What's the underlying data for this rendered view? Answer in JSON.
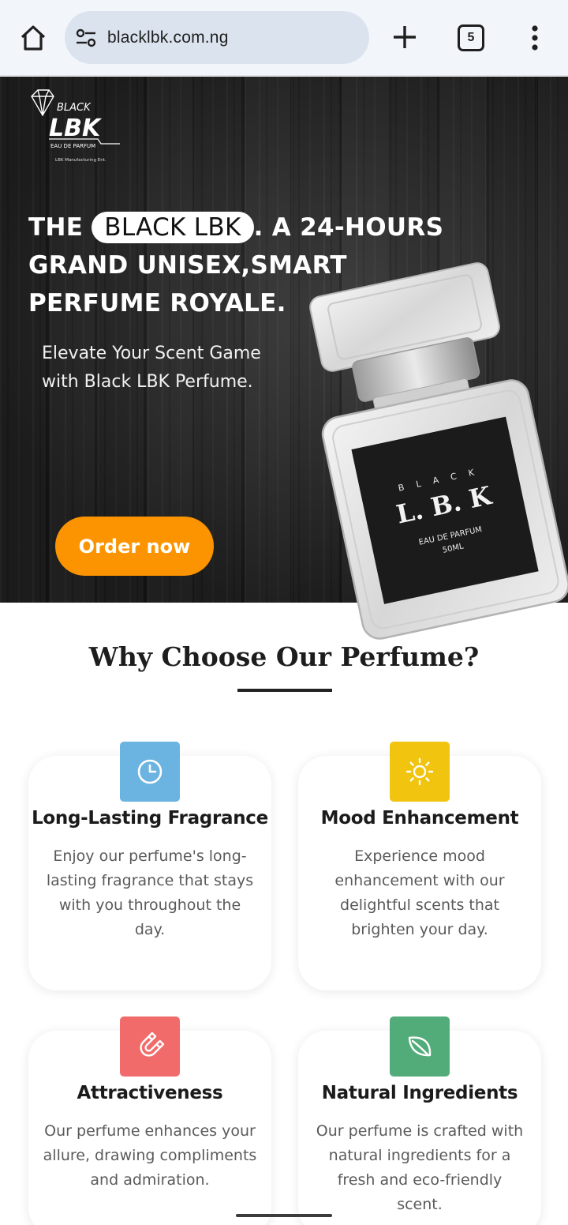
{
  "browser": {
    "url": "blacklbk.com.ng",
    "tab_count": "5"
  },
  "logo": {
    "brand_line1": "BLACK",
    "brand_line2": "LBK",
    "tagline": "EAU DE PARFUM",
    "subline": "LBK Manufacturing Ent."
  },
  "hero": {
    "title_prefix": "THE",
    "title_highlight": "BLACK LBK",
    "title_rest": ". A 24-HOURS GRAND UNISEX,SMART PERFUME ROYALE.",
    "subtitle": "Elevate Your Scent Game with Black LBK Perfume.",
    "cta_label": "Order now",
    "bottle_label": {
      "top": "B L A C K",
      "main": "L. B. K",
      "line1": "EAU DE PARFUM",
      "line2": "50ML"
    }
  },
  "features": {
    "title": "Why Choose Our Perfume?",
    "items": [
      {
        "icon": "clock-icon",
        "color": "#6bb3e0",
        "title": "Long-Lasting Fragrance",
        "text": "Enjoy our perfume's long-lasting fragrance that stays with you throughout the day."
      },
      {
        "icon": "sun-icon",
        "color": "#f1c40f",
        "title": "Mood Enhancement",
        "text": "Experience mood enhancement with our delightful scents that brighten your day."
      },
      {
        "icon": "magnet-icon",
        "color": "#f26b6b",
        "title": "Attractiveness",
        "text": "Our perfume enhances your allure, drawing compliments and admiration."
      },
      {
        "icon": "leaf-icon",
        "color": "#52ac7a",
        "title": "Natural Ingredients",
        "text": "Our perfume is crafted with natural ingredients for a fresh and eco-friendly scent."
      }
    ]
  },
  "colors": {
    "accent": "#fb9400",
    "chrome_bg": "#f2f6fb",
    "urlbar_bg": "#dbe4ee"
  }
}
